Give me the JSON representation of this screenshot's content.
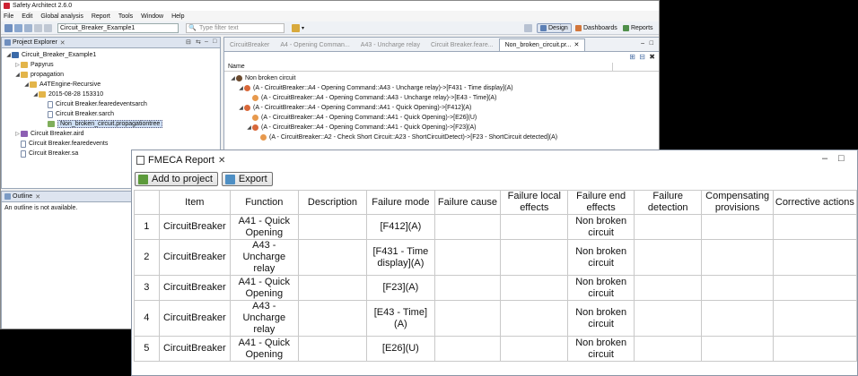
{
  "window": {
    "title": "Safety Architect 2.6.0"
  },
  "menu": [
    "File",
    "Edit",
    "Global analysis",
    "Report",
    "Tools",
    "Window",
    "Help"
  ],
  "toolbar": {
    "project_combo": "Circuit_Breaker_Example1",
    "filter_placeholder": "Type filter text",
    "perspectives": {
      "design": "Design",
      "dashboards": "Dashboards",
      "reports": "Reports"
    }
  },
  "explorer": {
    "tab": "Project Explorer",
    "tree": [
      {
        "label": "Circuit_Breaker_Example1",
        "icon": "project-icon"
      },
      {
        "label": "Papyrus",
        "icon": "folder-icon"
      },
      {
        "label": "propagation",
        "icon": "folder-icon"
      },
      {
        "label": "A4TEngine-Recursive",
        "icon": "folder-icon"
      },
      {
        "label": "2015-08-28 153310",
        "icon": "folder-icon"
      },
      {
        "label": "Circuit Breaker.fearedeventsarch",
        "icon": "file-icon"
      },
      {
        "label": "Circuit Breaker.sarch",
        "icon": "file-icon"
      },
      {
        "label": "Non_broken_circuit.propagationtree",
        "icon": "tree-icon"
      },
      {
        "label": "Circuit Breaker.aird",
        "icon": "aird-icon"
      },
      {
        "label": "Circuit Breaker.fearedevents",
        "icon": "file-icon"
      },
      {
        "label": "Circuit Breaker.sa",
        "icon": "file-icon"
      }
    ]
  },
  "outline": {
    "tab": "Outline",
    "message": "An outline is not available."
  },
  "editor": {
    "tabs": [
      "CircuitBreaker",
      "A4 - Opening Comman...",
      "A43 - Uncharge relay",
      "Circuit Breaker.feare...",
      "Non_broken_circuit.pr..."
    ],
    "column": "Name",
    "rows": [
      "Non broken circuit",
      "(A - CircuitBreaker::A4 - Opening Command::A43 - Uncharge relay)->[F431 - Time display](A)",
      "(A - CircuitBreaker::A4 - Opening Command::A43 - Uncharge relay)->[E43 - Time](A)",
      "(A - CircuitBreaker::A4 - Opening Command::A41 - Quick Opening)->[F412](A)",
      "(A - CircuitBreaker::A4 - Opening Command::A41 - Quick Opening)->[E26](U)",
      "(A - CircuitBreaker::A4 - Opening Command::A41 - Quick Opening)->[F23](A)",
      "(A - CircuitBreaker::A2 - Check Short Circuit::A23 - ShortCircuitDetect)->[F23 - ShortCircuit detected](A)"
    ]
  },
  "fmeca": {
    "title": "FMECA Report",
    "add_button": "Add to project",
    "export_button": "Export",
    "headers": [
      "",
      "Item",
      "Function",
      "Description",
      "Failure mode",
      "Failure cause",
      "Failure local effects",
      "Failure end effects",
      "Failure detection",
      "Compensating provisions",
      "Corrective actions"
    ],
    "rows": [
      {
        "num": "1",
        "item": "CircuitBreaker",
        "function": "A41 - Quick Opening",
        "description": "",
        "mode": "[F412](A)",
        "cause": "",
        "local": "",
        "end": "Non broken circuit",
        "detection": "",
        "comp": "",
        "corr": ""
      },
      {
        "num": "2",
        "item": "CircuitBreaker",
        "function": "A43 - Uncharge relay",
        "description": "",
        "mode": "[F431 - Time display](A)",
        "cause": "",
        "local": "",
        "end": "Non broken circuit",
        "detection": "",
        "comp": "",
        "corr": ""
      },
      {
        "num": "3",
        "item": "CircuitBreaker",
        "function": "A41 - Quick Opening",
        "description": "",
        "mode": "[F23](A)",
        "cause": "",
        "local": "",
        "end": "Non broken circuit",
        "detection": "",
        "comp": "",
        "corr": ""
      },
      {
        "num": "4",
        "item": "CircuitBreaker",
        "function": "A43 - Uncharge relay",
        "description": "",
        "mode": "[E43 - Time](A)",
        "cause": "",
        "local": "",
        "end": "Non broken circuit",
        "detection": "",
        "comp": "",
        "corr": ""
      },
      {
        "num": "5",
        "item": "CircuitBreaker",
        "function": "A41 - Quick Opening",
        "description": "",
        "mode": "[E26](U)",
        "cause": "",
        "local": "",
        "end": "Non broken circuit",
        "detection": "",
        "comp": "",
        "corr": ""
      }
    ]
  }
}
